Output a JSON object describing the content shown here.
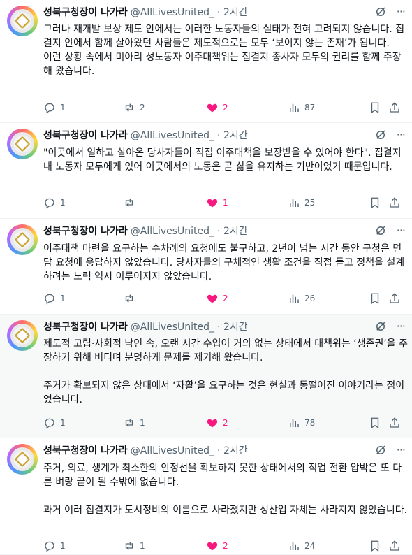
{
  "tweets": [
    {
      "name": "성북구청장이 나가라",
      "handle": "@AllLivesUnited_",
      "time": "· 2시간",
      "paragraphs": [
        "그러나 재개발 보상 제도 안에서는 이러한 노동자들의 실태가 전혀 고려되지 않습니다. 집결지 안에서 함께 살아왔던 사람들은 제도적으로는 모두 ‘보이지 않는 존재’가 됩니다.",
        "이런 상황 속에서 미아리 성노동자 이주대책위는 집결지 종사자 모두의 권리를 함께 주장해 왔습니다."
      ],
      "gaps": [
        false,
        false
      ],
      "replies": "1",
      "reposts": "2",
      "likes": "2",
      "views": "87"
    },
    {
      "name": "성북구청장이 나가라",
      "handle": "@AllLivesUnited_",
      "time": "· 2시간",
      "paragraphs": [
        "\"이곳에서 일하고 살아온 당사자들이 직접 이주대책을 보장받을 수 있어야 한다\". 집결지 내 노동자 모두에게 있어 이곳에서의 노동은 곧 삶을 유지하는 기반이었기 때문입니다."
      ],
      "gaps": [
        false
      ],
      "replies": "1",
      "reposts": "",
      "likes": "1",
      "views": "25"
    },
    {
      "name": "성북구청장이 나가라",
      "handle": "@AllLivesUnited_",
      "time": "· 2시간",
      "paragraphs": [
        "이주대책 마련을 요구하는 수차례의 요청에도 불구하고, 2년이 넘는 시간 동안 구청은 면담 요청에 응답하지 않았습니다. 당사자들의 구체적인 생활 조건을 직접 듣고 정책을 설계하려는 노력 역시 이루어지지 않았습니다."
      ],
      "gaps": [
        false
      ],
      "replies": "1",
      "reposts": "",
      "likes": "2",
      "views": "26"
    },
    {
      "name": "성북구청장이 나가라",
      "handle": "@AllLivesUnited_",
      "time": "· 2시간",
      "paragraphs": [
        "제도적 고립·사회적 낙인 속, 오랜 시간 수입이 거의 없는 상태에서 대책위는 ‘생존권’을 주장하기 위해 버티며 분명하게 문제를 제기해 왔습니다.",
        "주거가 확보되지 않은 상태에서 ‘자활’을 요구하는 것은 현실과 동떨어진 이야기라는 점이었습니다."
      ],
      "gaps": [
        false,
        true
      ],
      "replies": "1",
      "reposts": "1",
      "likes": "2",
      "views": "78"
    },
    {
      "name": "성북구청장이 나가라",
      "handle": "@AllLivesUnited_",
      "time": "· 2시간",
      "paragraphs": [
        "주거, 의료, 생계가 최소한의 안정선을 확보하지 못한 상태에서의 직업 전환 압박은 또 다른 벼랑 끝이 될 수밖에 없습니다.",
        "과거 여러 집결지가 도시정비의 이름으로 사라졌지만 성산업 자체는 사라지지 않았습니다."
      ],
      "gaps": [
        false,
        true
      ],
      "replies": "1",
      "reposts": "1",
      "likes": "2",
      "views": "24"
    }
  ],
  "colors": {
    "like": "#f91880",
    "muted": "#536471",
    "text": "#0f1419",
    "highlight_bg": "#f7f9f9"
  },
  "icons": [
    "reply-icon",
    "repost-icon",
    "like-icon",
    "views-icon",
    "bookmark-icon",
    "share-icon",
    "grok-icon",
    "more-icon"
  ]
}
